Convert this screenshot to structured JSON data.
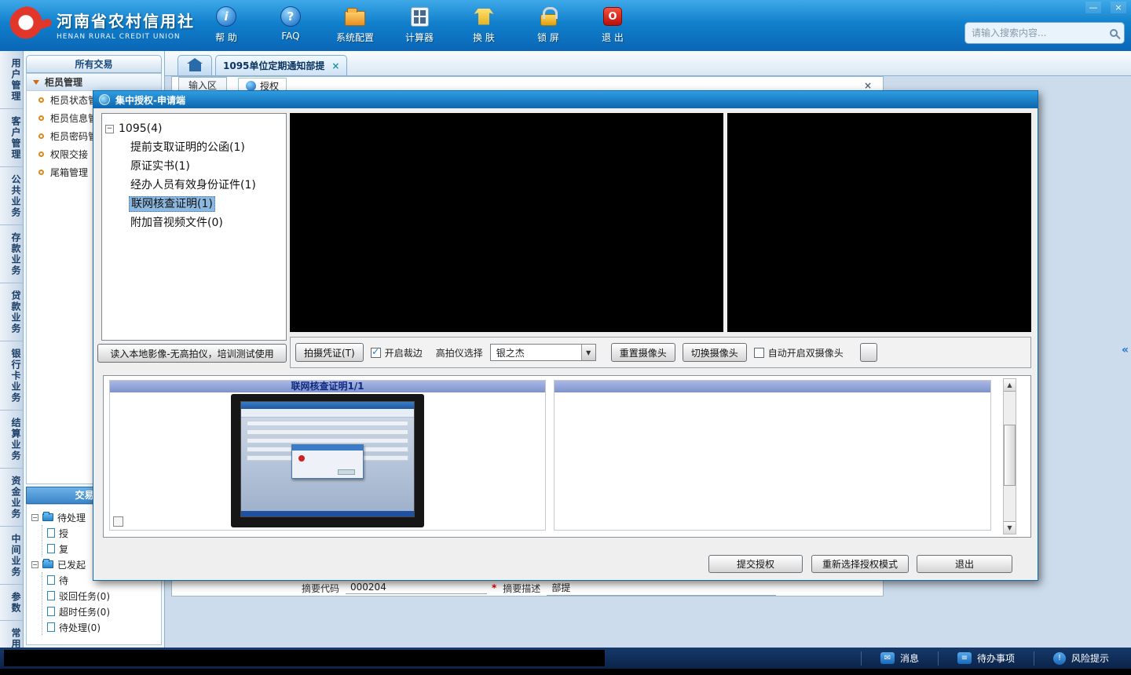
{
  "glyphs": {
    "minimize": "—",
    "close": "×",
    "check": "✓",
    "dropdown": "▼",
    "up": "▲",
    "down": "▼",
    "collapse": "«",
    "minus": "−",
    "help": "i",
    "question": "?",
    "power": "O",
    "envelope": "✉",
    "todo": "≡",
    "warning": "!"
  },
  "header": {
    "logo": {
      "title": "河南省农村信用社",
      "subtitle": "HENAN RURAL CREDIT UNION"
    },
    "toolbar": [
      {
        "label": "帮 助"
      },
      {
        "label": "FAQ"
      },
      {
        "label": "系统配置"
      },
      {
        "label": "计算器"
      },
      {
        "label": "换 肤"
      },
      {
        "label": "锁 屏"
      },
      {
        "label": "退 出"
      }
    ],
    "search": {
      "placeholder": "请输入搜索内容..."
    }
  },
  "vertical_tabs": [
    "用户管理",
    "客户管理",
    "公共业务",
    "存款业务",
    "贷款业务",
    "银行卡业务",
    "结算业务",
    "资金业务",
    "中间业务",
    "参数",
    "常用工具"
  ],
  "sidebar": {
    "all_transactions": "所有交易",
    "group": "柜员管理",
    "items": [
      "柜员状态管理",
      "柜员信息管理",
      "柜员密码管理",
      "权限交接",
      "尾箱管理"
    ],
    "info_title": "交易信息",
    "pending_root": "待处理",
    "pending_children": [
      "授",
      "复"
    ],
    "initiated_root": "已发起",
    "initiated_children": [
      "待",
      "驳回任务(0)",
      "超时任务(0)",
      "待处理(0)"
    ]
  },
  "tabs": {
    "active": "1095单位定期通知部提"
  },
  "form": {
    "input_area": "输入区",
    "auth_tab": "授权",
    "summary_code_label": "摘要代码",
    "summary_code_value": "000204",
    "required": "*",
    "summary_desc_label": "摘要描述",
    "summary_desc_value": "部提"
  },
  "dialog": {
    "title": "集中授权-申请端",
    "tree_root": "1095(4)",
    "tree_items": [
      {
        "label": "提前支取证明的公函(1)",
        "selected": false
      },
      {
        "label": "原证实书(1)",
        "selected": false
      },
      {
        "label": "经办人员有效身份证件(1)",
        "selected": false
      },
      {
        "label": "联网核查证明(1)",
        "selected": true
      },
      {
        "label": "附加音视频文件(0)",
        "selected": false
      }
    ],
    "read_local_button": "读入本地影像-无高拍仪，培训测试使用",
    "capture_voucher_button": "拍摄凭证(T)",
    "crop_label": "开启裁边",
    "crop_checked": true,
    "scanner_label": "高拍仪选择",
    "scanner_value": "银之杰",
    "reset_camera_button": "重置摄像头",
    "switch_camera_button": "切换摄像头",
    "dual_camera_label": "自动开启双摄像头",
    "dual_camera_checked": false,
    "left_panel_title": "联网核查证明1/1",
    "submit_button": "提交授权",
    "reselect_button": "重新选择授权模式",
    "exit_button": "退出"
  },
  "statusbar": {
    "messages": "消息",
    "todo": "待办事项",
    "risk": "风险提示"
  },
  "colors": {
    "header_blue": "#1180cc",
    "dialog_title_blue": "#1b86cf",
    "panel_header_purple": "#8ea2d8",
    "selection_blue": "#8cb8e0",
    "required_red": "#e00000"
  }
}
